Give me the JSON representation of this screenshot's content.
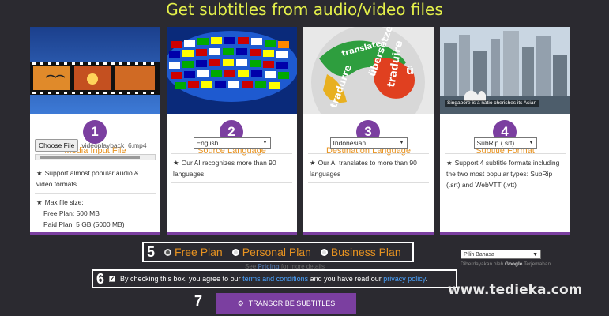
{
  "page": {
    "title": "Get subtitles from audio/video files"
  },
  "cards": [
    {
      "step": "1",
      "title": "Media Input File",
      "file_button": "Choose File",
      "file_name": "videoplayback_6.mp4",
      "features": [
        "Support almost popular audio & video formats",
        "Max file size:"
      ],
      "limits": [
        "Free Plan: 500 MB",
        "Paid Plan: 5 GB (5000 MB)"
      ]
    },
    {
      "step": "2",
      "title": "Source Language",
      "select_value": "English",
      "features": [
        "Our AI recognizes more than 90 languages"
      ]
    },
    {
      "step": "3",
      "title": "Destination Language",
      "select_value": "Indonesian",
      "features": [
        "Our AI translates to more than 90 languages"
      ],
      "image_words": [
        "translate",
        "übersetzen",
        "traduire",
        "tradurre",
        "ü"
      ]
    },
    {
      "step": "4",
      "title": "Subtitle Format",
      "select_value": "SubRip (.srt)",
      "features": [
        "Support 4 subtitle formats including the two most popular types: SubRip (.srt) and WebVTT (.vtt)"
      ],
      "image_caption": "Singapore is a natio  cherishes its Asian"
    }
  ],
  "plans": {
    "step": "5",
    "options": [
      "Free Plan",
      "Personal Plan",
      "Business Plan"
    ],
    "selected_index": 0
  },
  "pricing_note": {
    "prefix": "See ",
    "link": "Pricing",
    "suffix": " for more details"
  },
  "terms": {
    "step": "6",
    "text_before": "By checking this box, you agree to our ",
    "terms_link": "terms and conditions",
    "text_middle": " and you have read our ",
    "privacy_link": "privacy policy",
    "text_after": ".",
    "checked": true
  },
  "transcribe": {
    "step": "7",
    "label": "TRANSCRIBE SUBTITLES",
    "icon": "gears-icon"
  },
  "translate_widget": {
    "select_label": "Pilih Bahasa",
    "powered_prefix": "Diberdayakan oleh ",
    "powered_brand": "Google",
    "powered_suffix": " Terjemahan"
  },
  "watermark": "www.tedieka.com",
  "colors": {
    "accent": "#7b3fa0",
    "title": "#e4f04a",
    "label_orange": "#e89320",
    "link": "#4aa3ff"
  }
}
